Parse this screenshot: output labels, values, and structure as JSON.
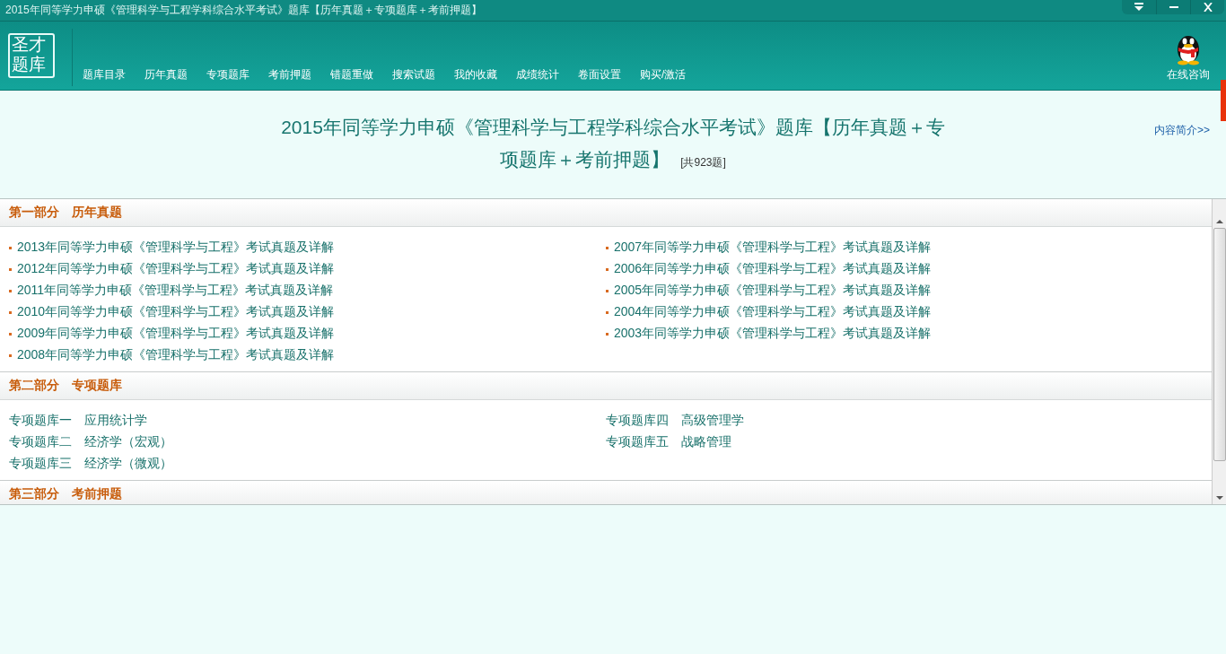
{
  "window": {
    "title": "2015年同等学力申硕《管理科学与工程学科综合水平考试》题库【历年真题＋专项题库＋考前押题】"
  },
  "logo": {
    "line_1": "圣才",
    "line_2": "题库"
  },
  "nav": [
    "题库目录",
    "历年真题",
    "专项题库",
    "考前押题",
    "错题重做",
    "搜索试题",
    "我的收藏",
    "成绩统计",
    "卷面设置",
    "购买/激活"
  ],
  "consult": {
    "label": "在线咨询"
  },
  "heading": {
    "title": "2015年同等学力申硕《管理科学与工程学科综合水平考试》题库【历年真题＋专项题库＋考前押题】",
    "count": "[共923题]",
    "intro_link": "内容简介>>"
  },
  "sections": [
    {
      "title": "第一部分　历年真题",
      "kind": "bulleted",
      "left": [
        "2013年同等学力申硕《管理科学与工程》考试真题及详解",
        "2012年同等学力申硕《管理科学与工程》考试真题及详解",
        "2011年同等学力申硕《管理科学与工程》考试真题及详解",
        "2010年同等学力申硕《管理科学与工程》考试真题及详解",
        "2009年同等学力申硕《管理科学与工程》考试真题及详解",
        "2008年同等学力申硕《管理科学与工程》考试真题及详解"
      ],
      "right": [
        "2007年同等学力申硕《管理科学与工程》考试真题及详解",
        "2006年同等学力申硕《管理科学与工程》考试真题及详解",
        "2005年同等学力申硕《管理科学与工程》考试真题及详解",
        "2004年同等学力申硕《管理科学与工程》考试真题及详解",
        "2003年同等学力申硕《管理科学与工程》考试真题及详解"
      ]
    },
    {
      "title": "第二部分　专项题库",
      "kind": "plain",
      "left": [
        "专项题库一　应用统计学",
        "专项题库二　经济学（宏观）",
        "专项题库三　经济学（微观）"
      ],
      "right": [
        "专项题库四　高级管理学",
        "专项题库五　战略管理"
      ]
    },
    {
      "title": "第三部分　考前押题"
    }
  ]
}
